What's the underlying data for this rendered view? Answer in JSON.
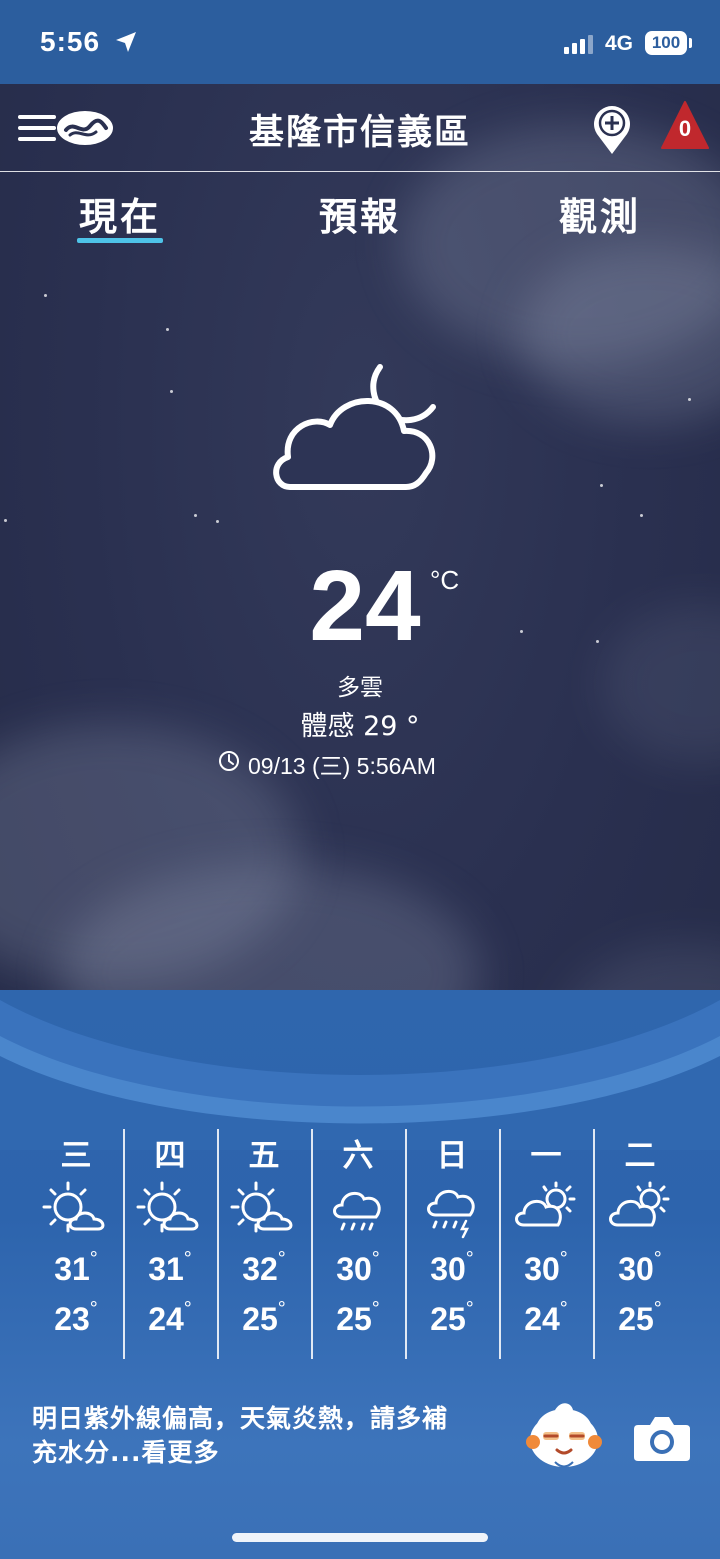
{
  "status_bar": {
    "time": "5:56",
    "network": "4G",
    "battery": "100"
  },
  "header": {
    "location": "基隆市信義區",
    "alert_count": "0",
    "icons": [
      "menu-logo-icon",
      "add-location-icon",
      "alert-triangle-icon"
    ]
  },
  "tabs": [
    {
      "label": "現在",
      "active": true
    },
    {
      "label": "預報",
      "active": false
    },
    {
      "label": "觀測",
      "active": false
    }
  ],
  "current": {
    "icon": "partly-cloudy-night-icon",
    "temperature": "24",
    "unit": "°C",
    "condition": "多雲",
    "feels_like": "體感 29 °",
    "observed_at": "09/13 (三) 5:56AM"
  },
  "forecast": [
    {
      "day": "三",
      "icon": "sunny-cloudy-icon",
      "high": "31",
      "low": "23"
    },
    {
      "day": "四",
      "icon": "sunny-cloudy-icon",
      "high": "31",
      "low": "24"
    },
    {
      "day": "五",
      "icon": "sunny-cloudy-icon",
      "high": "32",
      "low": "25"
    },
    {
      "day": "六",
      "icon": "rain-icon",
      "high": "30",
      "low": "25"
    },
    {
      "day": "日",
      "icon": "thunder-rain-icon",
      "high": "30",
      "low": "25"
    },
    {
      "day": "一",
      "icon": "cloudy-sun-icon",
      "high": "30",
      "low": "24"
    },
    {
      "day": "二",
      "icon": "cloudy-sun-icon",
      "high": "30",
      "low": "25"
    }
  ],
  "degree_symbol": "°",
  "tip": {
    "line1": "明日紫外線偏高，天氣炎熱，請多補",
    "line2": "充水分...看更多"
  },
  "colors": {
    "status_bar": "#2c5e9e",
    "tab_indicator": "#4ec3e8",
    "panel": "#2f66ad",
    "alert": "#c0282d"
  }
}
